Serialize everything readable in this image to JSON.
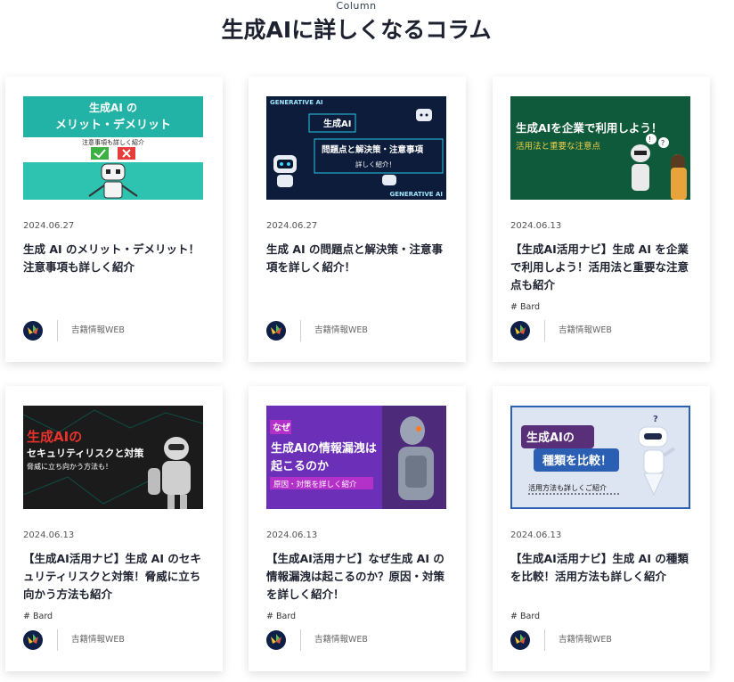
{
  "section": {
    "label": "Column",
    "title": "生成AIに詳しくなるコラム"
  },
  "cards": [
    {
      "date": "2024.06.27",
      "title": "生成 AI のメリット・デメリット！注意事項も詳しく紹介",
      "tag": "",
      "author": "吉籍情報WEB",
      "thumb": {
        "line1": "生成AI の",
        "line2": "メリット・デメリット",
        "line3": "注意事項も詳しく紹介"
      }
    },
    {
      "date": "2024.06.27",
      "title": "生成 AI の問題点と解決策・注意事項を詳しく紹介！",
      "tag": "",
      "author": "吉籍情報WEB",
      "thumb": {
        "brand": "GENERATIVE AI",
        "line1": "生成AI",
        "line2": "問題点と解決策・注意事項",
        "line3": "詳しく紹介！"
      }
    },
    {
      "date": "2024.06.13",
      "title": "【生成AI活用ナビ】生成 AI を企業で利用しよう！活用法と重要な注意点も紹介",
      "tag": "# Bard",
      "author": "吉籍情報WEB",
      "thumb": {
        "line1": "生成AIを企業で利用しよう！",
        "line2": "活用法と重要な注意点"
      }
    },
    {
      "date": "2024.06.13",
      "title": "【生成AI活用ナビ】生成 AI のセキュリティリスクと対策！脅威に立ち向かう方法も紹介",
      "tag": "# Bard",
      "author": "吉籍情報WEB",
      "thumb": {
        "line1": "生成AIの",
        "line2": "セキュリティリスクと対策",
        "line3": "脅威に立ち向かう方法も！"
      }
    },
    {
      "date": "2024.06.13",
      "title": "【生成AI活用ナビ】なぜ生成 AI の情報漏洩は起こるのか？原因・対策を詳しく紹介！",
      "tag": "# Bard",
      "author": "吉籍情報WEB",
      "thumb": {
        "line0": "なぜ",
        "line1": "生成AIの情報漏洩は",
        "line2": "起こるのか",
        "line3": "原因・対策を詳しく紹介"
      }
    },
    {
      "date": "2024.06.13",
      "title": "【生成AI活用ナビ】生成 AI の種類を比較！活用方法も詳しく紹介",
      "tag": "# Bard",
      "author": "吉籍情報WEB",
      "thumb": {
        "line1": "生成AIの",
        "line2": "種類を比較！",
        "line3": "活用方法も詳しくご紹介"
      }
    }
  ],
  "colors": {
    "thumb1": "#2ec2b0",
    "thumb2": "#0c1c3a",
    "thumb3": "#0f5a3a",
    "thumb4": "#1b1b1b",
    "thumb5": "#6b2fb8",
    "thumb6": "#dde5f2",
    "logo": "#0e1f48"
  },
  "icons": {
    "author_logo": "leaf-logo-icon"
  }
}
